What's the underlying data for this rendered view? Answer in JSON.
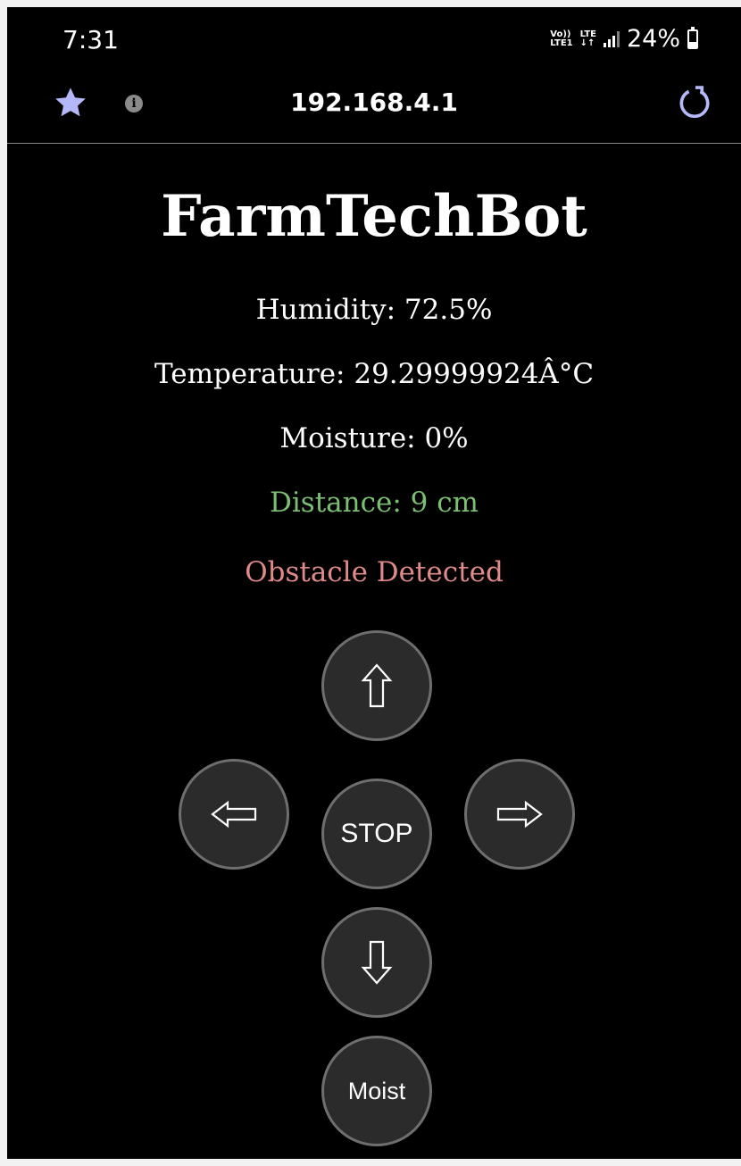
{
  "status_bar": {
    "time": "7:31",
    "volte_top": "Vo))",
    "volte_bottom": "LTE1",
    "lte_top": "LTE",
    "lte_bottom": "↓↑",
    "battery": "24%"
  },
  "browser": {
    "url": "192.168.4.1",
    "icons": [
      "star-icon",
      "info-icon",
      "reload-icon"
    ],
    "accent_color": "#b4b8f8"
  },
  "page": {
    "title": "FarmTechBot",
    "humidity": "Humidity: 72.5%",
    "temperature": "Temperature: 29.29999924Â°C",
    "moisture": "Moisture: 0%",
    "distance": "Distance: 9 cm",
    "obstacle": "Obstacle Detected",
    "distance_color": "#7bbf72",
    "obstacle_color": "#e08a8a"
  },
  "controls": {
    "forward_icon": "arrow-up-icon",
    "left_icon": "arrow-left-icon",
    "stop_label": "STOP",
    "right_icon": "arrow-right-icon",
    "backward_icon": "arrow-down-icon",
    "moist_label": "Moist"
  }
}
